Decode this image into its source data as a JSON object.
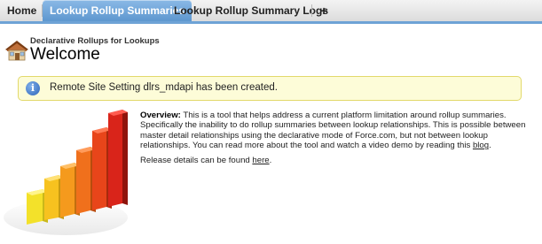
{
  "tabs": {
    "home": "Home",
    "lookup_rollup_summaries": "Lookup Rollup Summaries",
    "lookup_rollup_summary_logs": "Lookup Rollup Summary Logs",
    "add": "+"
  },
  "header": {
    "page_type": "Declarative Rollups for Lookups",
    "title": "Welcome"
  },
  "message": {
    "icon": "info-icon",
    "text": "Remote Site Setting dlrs_mdapi has been created."
  },
  "overview": {
    "label": "Overview:",
    "text_1": " This is a tool that helps address a current platform limitation around rollup summaries. Specifically the inability to do rollup summaries between lookup relationships. This is possible between master detail relationships using the declarative mode of Force.com, but not between lookup relationships. You can read more about the tool and watch a video demo by reading this ",
    "blog_link": "blog",
    "text_2": "."
  },
  "release": {
    "text": "Release details can be found ",
    "link": "here",
    "end": "."
  },
  "colors": {
    "tab_active": "#5e97cf",
    "tab_border": "#6ea3d6",
    "message_bg": "#fdfcd8",
    "message_border": "#e2d96b"
  }
}
